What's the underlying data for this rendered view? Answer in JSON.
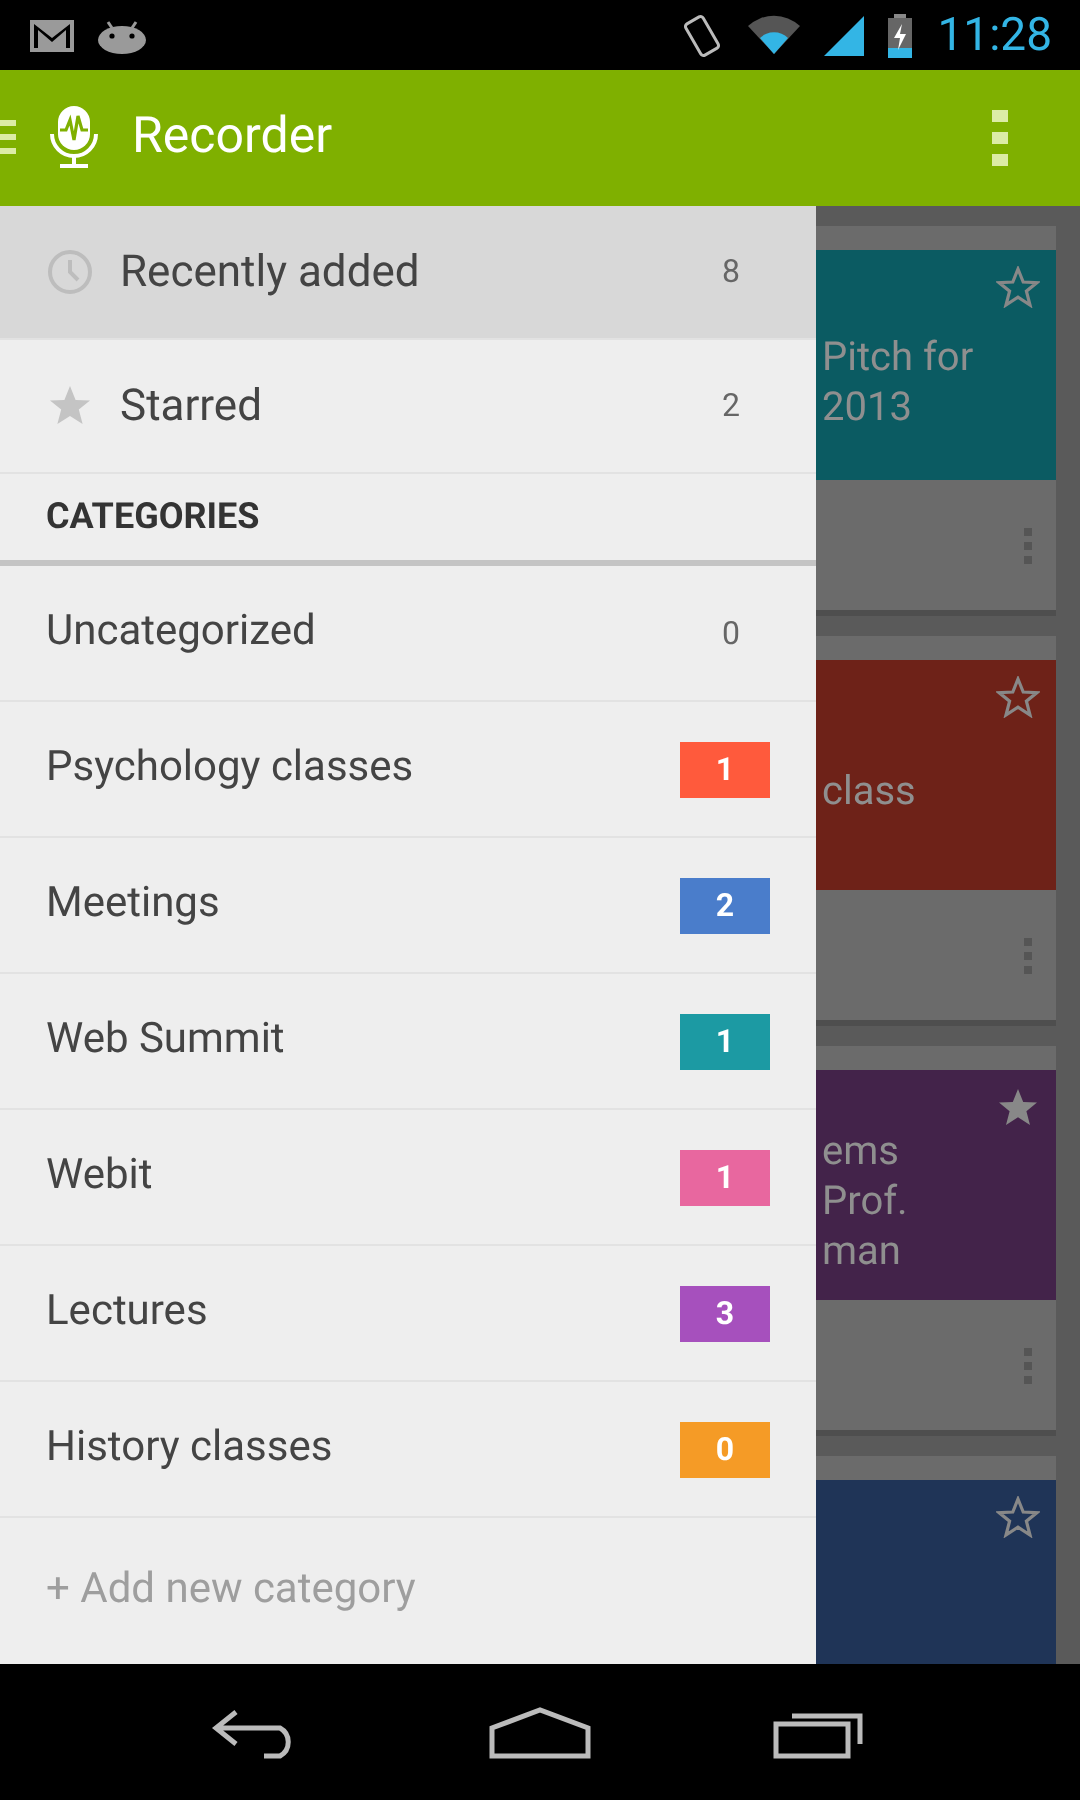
{
  "status_bar": {
    "time": "11:28"
  },
  "app_bar": {
    "title": "Recorder"
  },
  "drawer": {
    "items": [
      {
        "kind": "recent",
        "label": "Recently added",
        "count": "8",
        "selected": true
      },
      {
        "kind": "starred",
        "label": "Starred",
        "count": "2",
        "selected": false
      }
    ],
    "section_header": "CATEGORIES",
    "categories": [
      {
        "kind": "plain",
        "label": "Uncategorized",
        "count": "0"
      },
      {
        "kind": "badge",
        "label": "Psychology classes",
        "count": "1",
        "color": "#ff5a3c"
      },
      {
        "kind": "badge",
        "label": "Meetings",
        "count": "2",
        "color": "#4a7dcb"
      },
      {
        "kind": "badge",
        "label": "Web Summit",
        "count": "1",
        "color": "#1c9aa3"
      },
      {
        "kind": "badge",
        "label": "Webit",
        "count": "1",
        "color": "#e8679f"
      },
      {
        "kind": "badge",
        "label": "Lectures",
        "count": "3",
        "color": "#a650bd"
      },
      {
        "kind": "badge",
        "label": "History classes",
        "count": "0",
        "color": "#f59b26"
      }
    ],
    "add_category": "+ Add new category"
  },
  "recordings": [
    {
      "lines": [
        "Pitch for",
        "2013"
      ],
      "color": "#0b5b62",
      "starred": false
    },
    {
      "lines": [
        "class"
      ],
      "color": "#6e2218",
      "starred": false
    },
    {
      "lines": [
        "ems",
        "Prof.",
        "man"
      ],
      "color": "#43234a",
      "starred": true
    },
    {
      "color": "#1f3457",
      "starred": false
    }
  ]
}
